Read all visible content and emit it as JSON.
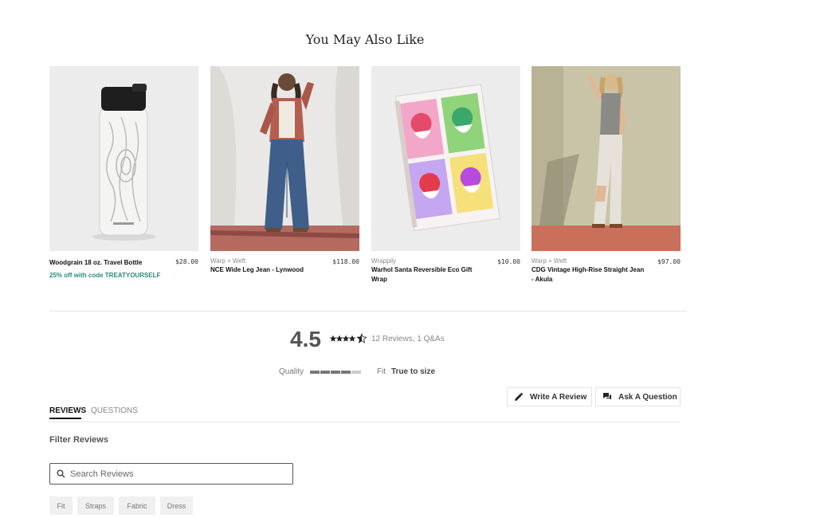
{
  "section": {
    "title": "You May Also Like"
  },
  "products": [
    {
      "brand": "",
      "name": "Woodgrain 18 oz. Travel Bottle",
      "price": "$28.00",
      "promo": "25% off with code TREATYOURSELF"
    },
    {
      "brand": "Warp + Weft",
      "name": "NCE Wide Leg Jean - Lynwood",
      "price": "$118.00",
      "promo": ""
    },
    {
      "brand": "Wrappily",
      "name": "Warhol Santa Reversible Eco Gift Wrap",
      "price": "$10.00",
      "promo": ""
    },
    {
      "brand": "Warp + Weft",
      "name": "CDG Vintage High-Rise Straight Jean - Akula",
      "price": "$97.00",
      "promo": ""
    }
  ],
  "reviews_summary": {
    "rating": "4.5",
    "star_value": 4.5,
    "stars_max": 5,
    "count_text": "12 Reviews, 1 Q&As",
    "quality_label": "Quality",
    "quality_level": 0.8,
    "fit_label": "Fit",
    "fit_value": "True to size"
  },
  "actions": {
    "write_review": "Write A Review",
    "ask_question": "Ask A Question"
  },
  "tabs": [
    {
      "label": "REVIEWS",
      "active": true
    },
    {
      "label": "QUESTIONS",
      "active": false
    }
  ],
  "filter": {
    "title": "Filter Reviews",
    "search_placeholder": "Search Reviews",
    "chips": [
      "Fit",
      "Straps",
      "Fabric",
      "Dress"
    ]
  },
  "colors": {
    "promo": "#2a8a7a",
    "text": "#222222",
    "muted": "#888888"
  },
  "icons": [
    "search-icon",
    "pencil-icon",
    "chat-icon",
    "star-icon"
  ]
}
